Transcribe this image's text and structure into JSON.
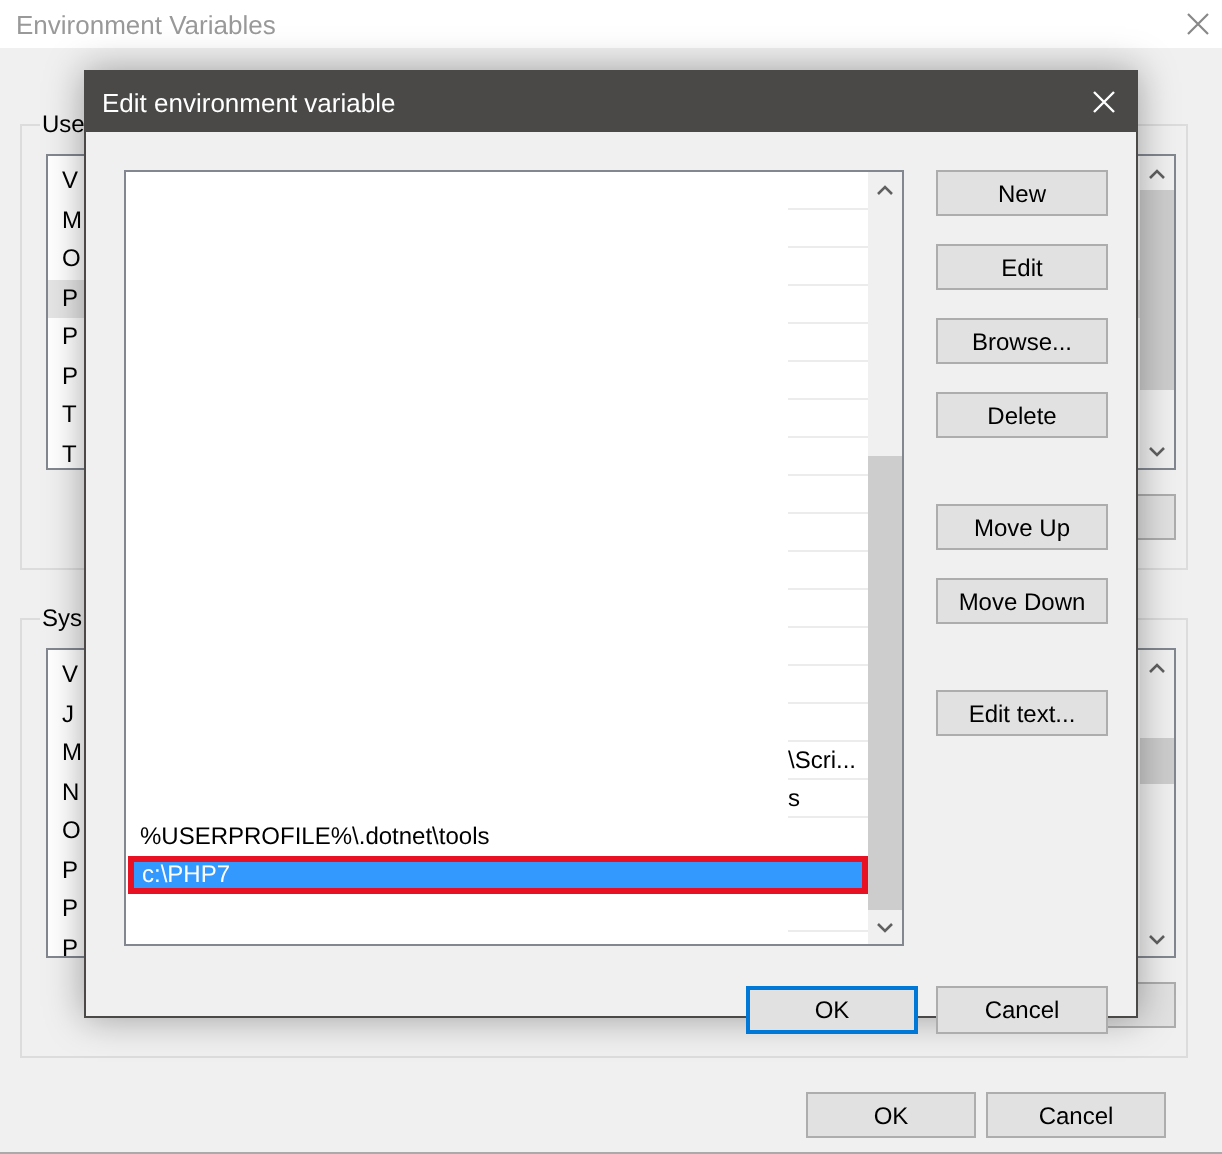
{
  "window": {
    "title": "Environment Variables"
  },
  "user_variables": {
    "label": "Use",
    "header": "V",
    "rows": [
      {
        "text": "M",
        "selected": false
      },
      {
        "text": "O",
        "selected": false
      },
      {
        "text": "P",
        "selected": true
      },
      {
        "text": "P",
        "selected": false
      },
      {
        "text": "P",
        "selected": false
      },
      {
        "text": "T",
        "selected": false
      },
      {
        "text": "T",
        "selected": false
      }
    ]
  },
  "system_variables": {
    "label": "Sys",
    "header": "V",
    "rows": [
      {
        "text": "J",
        "selected": false
      },
      {
        "text": "M",
        "selected": false
      },
      {
        "text": "N",
        "selected": false
      },
      {
        "text": "O",
        "selected": false
      },
      {
        "text": "P",
        "selected": false
      },
      {
        "text": "P",
        "selected": false
      },
      {
        "text": "P",
        "selected": false
      }
    ]
  },
  "buttons": [
    {
      "label": "OK"
    },
    {
      "label": "Cancel"
    }
  ],
  "dialog": {
    "title": "Edit environment variable",
    "entries": [
      {
        "kind": "blank",
        "selected": false,
        "outlined": false
      },
      {
        "kind": "blank",
        "selected": false,
        "outlined": false
      },
      {
        "kind": "blank",
        "selected": false,
        "outlined": false
      },
      {
        "kind": "blank",
        "selected": false,
        "outlined": false
      },
      {
        "kind": "blank",
        "selected": false,
        "outlined": false
      },
      {
        "kind": "blank",
        "selected": false,
        "outlined": false
      },
      {
        "kind": "blank",
        "selected": false,
        "outlined": false
      },
      {
        "kind": "blank",
        "selected": false,
        "outlined": false
      },
      {
        "kind": "blank",
        "selected": false,
        "outlined": false
      },
      {
        "kind": "blank",
        "selected": false,
        "outlined": false
      },
      {
        "kind": "blank",
        "selected": false,
        "outlined": false
      },
      {
        "kind": "blank",
        "selected": false,
        "outlined": false
      },
      {
        "kind": "blank",
        "selected": false,
        "outlined": false
      },
      {
        "kind": "blank",
        "selected": false,
        "outlined": false
      },
      {
        "kind": "blank",
        "selected": false,
        "outlined": false
      },
      {
        "kind": "partial",
        "text": "\\Scri...",
        "selected": false,
        "outlined": false
      },
      {
        "kind": "partial",
        "text": "s",
        "selected": false,
        "outlined": false
      },
      {
        "kind": "full",
        "text": "%USERPROFILE%\\.dotnet\\tools",
        "selected": false,
        "outlined": false
      },
      {
        "kind": "full",
        "text": "c:\\PHP7",
        "selected": true,
        "outlined": true
      },
      {
        "kind": "blank",
        "selected": false,
        "outlined": false
      }
    ],
    "side_buttons": [
      [
        "New",
        "Edit",
        "Browse...",
        "Delete"
      ],
      [
        "Move Up",
        "Move Down"
      ],
      [
        "Edit text..."
      ]
    ],
    "footer_buttons": [
      {
        "label": "OK",
        "default": true
      },
      {
        "label": "Cancel",
        "default": false
      }
    ]
  }
}
